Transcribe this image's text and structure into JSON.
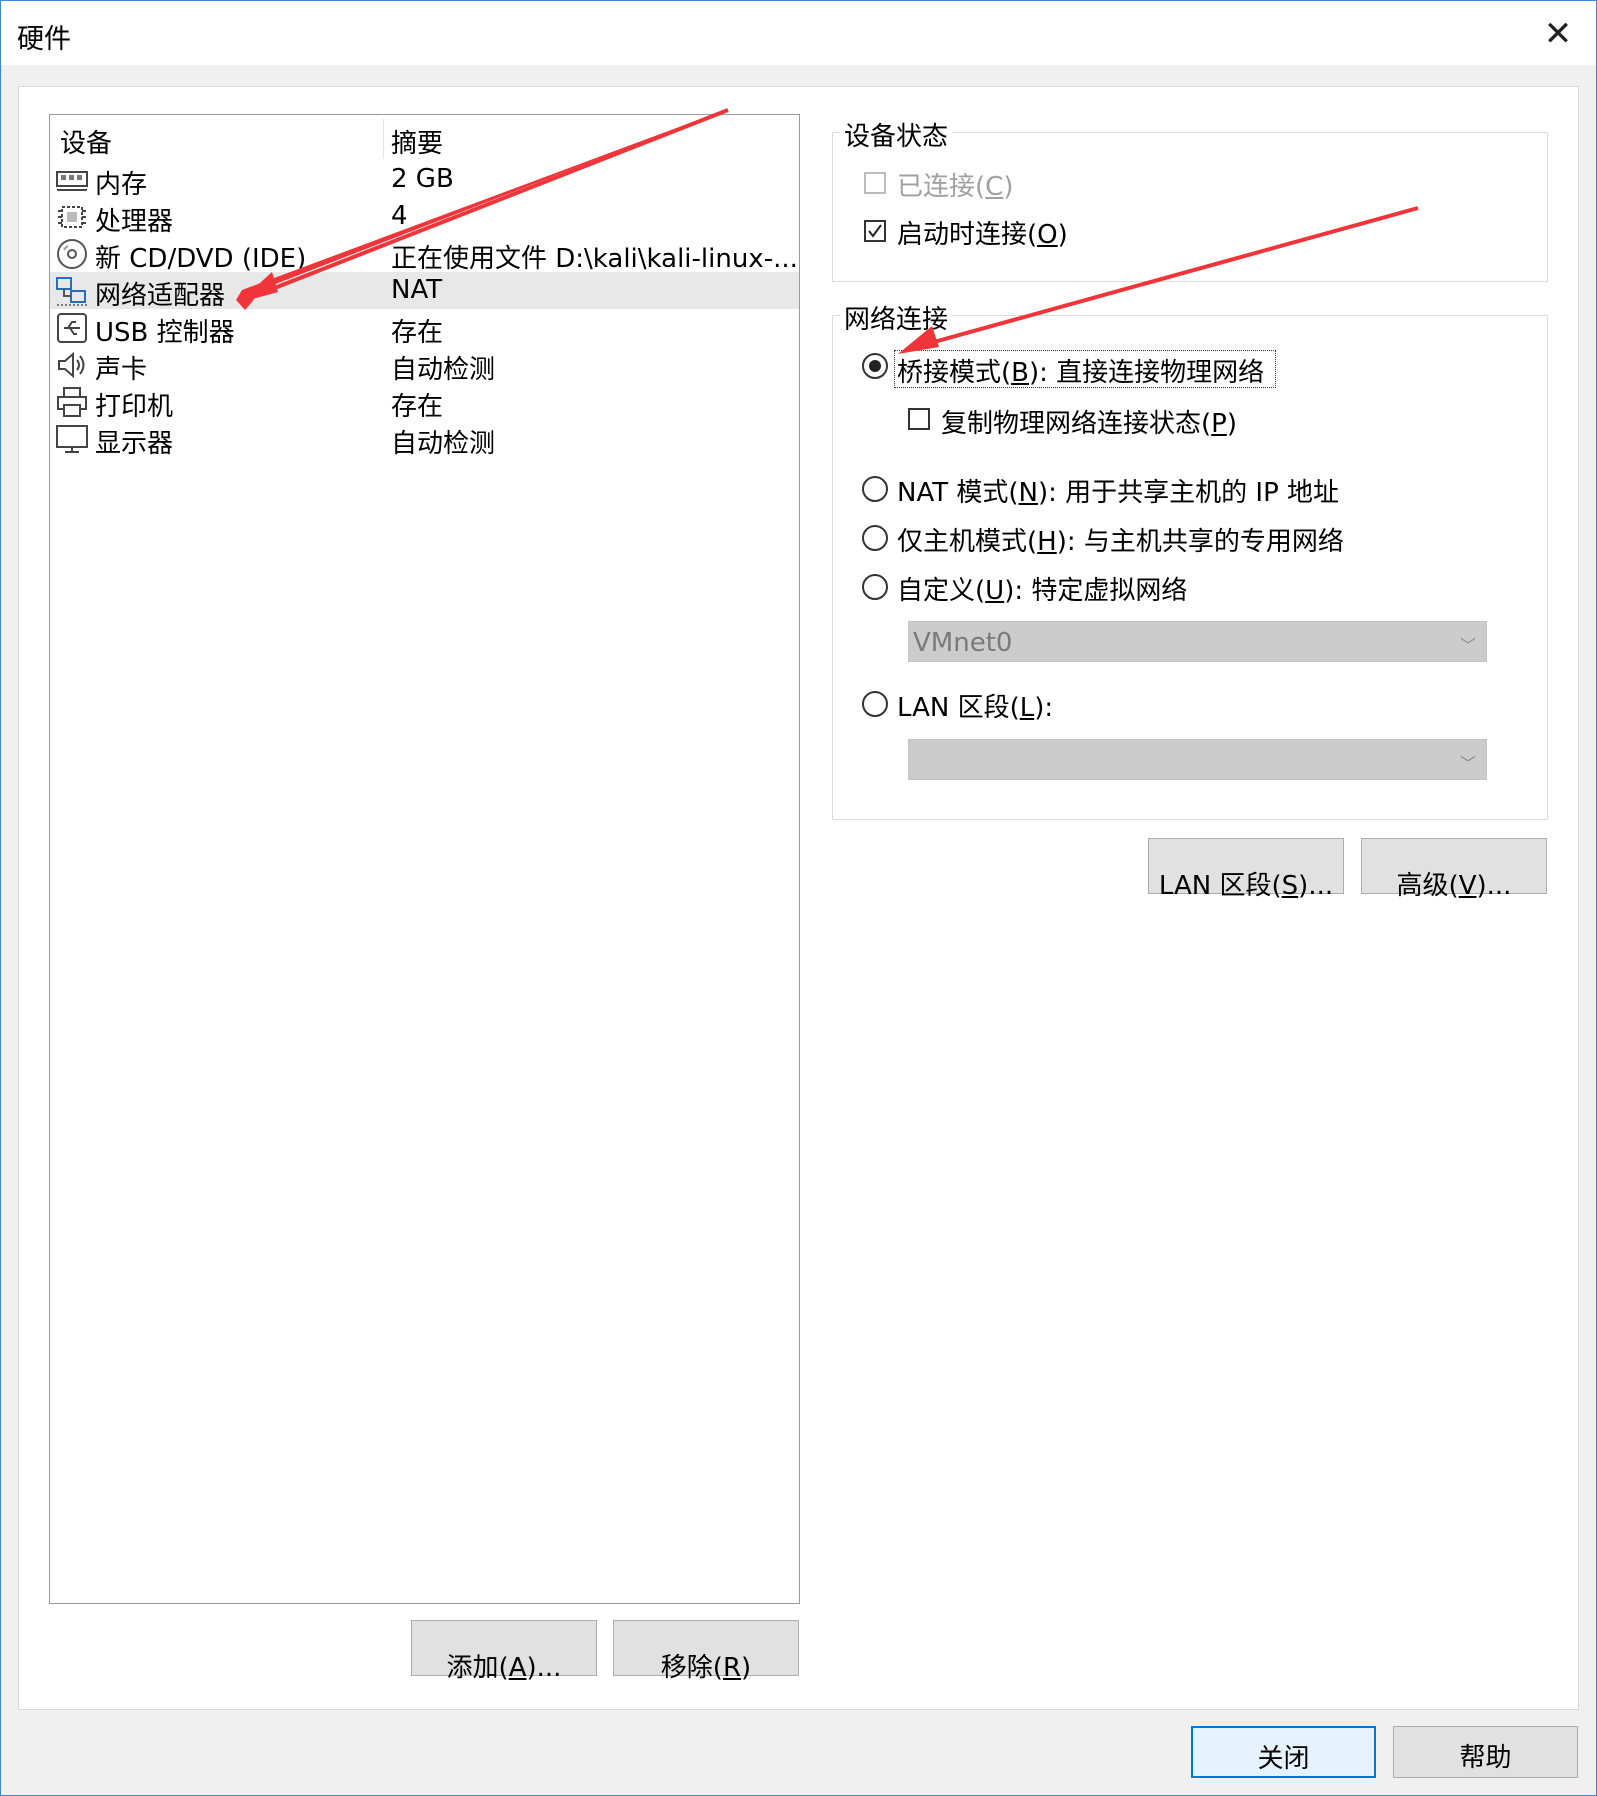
{
  "window": {
    "title": "硬件",
    "close_label": "✕"
  },
  "device_list": {
    "headers": {
      "device": "设备",
      "summary": "摘要"
    },
    "rows": [
      {
        "name": "内存",
        "summary": "2 GB",
        "icon": "memory-icon"
      },
      {
        "name": "处理器",
        "summary": "4",
        "icon": "processor-icon"
      },
      {
        "name": "新 CD/DVD (IDE)",
        "summary": "正在使用文件 D:\\kali\\kali-linux-...",
        "icon": "cd-dvd-icon"
      },
      {
        "name": "网络适配器",
        "summary": "NAT",
        "icon": "network-adapter-icon"
      },
      {
        "name": "USB 控制器",
        "summary": "存在",
        "icon": "usb-icon"
      },
      {
        "name": "声卡",
        "summary": "自动检测",
        "icon": "speaker-icon"
      },
      {
        "name": "打印机",
        "summary": "存在",
        "icon": "printer-icon"
      },
      {
        "name": "显示器",
        "summary": "自动检测",
        "icon": "monitor-icon"
      }
    ],
    "selected_index": 3
  },
  "left_buttons": {
    "add": {
      "pre": "添加(",
      "key": "A",
      "post": ")..."
    },
    "remove": {
      "pre": "移除(",
      "key": "R",
      "post": ")"
    }
  },
  "device_status": {
    "title": "设备状态",
    "connected": {
      "pre": "已连接(",
      "key": "C",
      "post": ")",
      "checked": false,
      "enabled": false
    },
    "connect_at_power_on": {
      "pre": "启动时连接(",
      "key": "O",
      "post": ")",
      "checked": true,
      "enabled": true
    }
  },
  "network_connection": {
    "title": "网络连接",
    "bridged": {
      "pre": "桥接模式(",
      "key": "B",
      "post": "): 直接连接物理网络",
      "selected": true
    },
    "replicate": {
      "pre": "复制物理网络连接状态(",
      "key": "P",
      "post": ")",
      "checked": false
    },
    "nat": {
      "pre": "NAT 模式(",
      "key": "N",
      "post": "): 用于共享主机的 IP 地址",
      "selected": false
    },
    "host_only": {
      "pre": "仅主机模式(",
      "key": "H",
      "post": "): 与主机共享的专用网络",
      "selected": false
    },
    "custom": {
      "pre": "自定义(",
      "key": "U",
      "post": "): 特定虚拟网络",
      "selected": false
    },
    "custom_select_value": "VMnet0",
    "lan_segment": {
      "pre": "LAN 区段(",
      "key": "L",
      "post": "):",
      "selected": false
    },
    "lan_segment_select_value": ""
  },
  "right_buttons": {
    "lan_segments": {
      "pre": "LAN 区段(",
      "key": "S",
      "post": ")..."
    },
    "advanced": {
      "pre": "高级(",
      "key": "V",
      "post": ")..."
    }
  },
  "footer": {
    "close": "关闭",
    "help": "帮助"
  },
  "colors": {
    "annotation_arrow": "#f0353a",
    "focus_border": "#0078d7"
  }
}
